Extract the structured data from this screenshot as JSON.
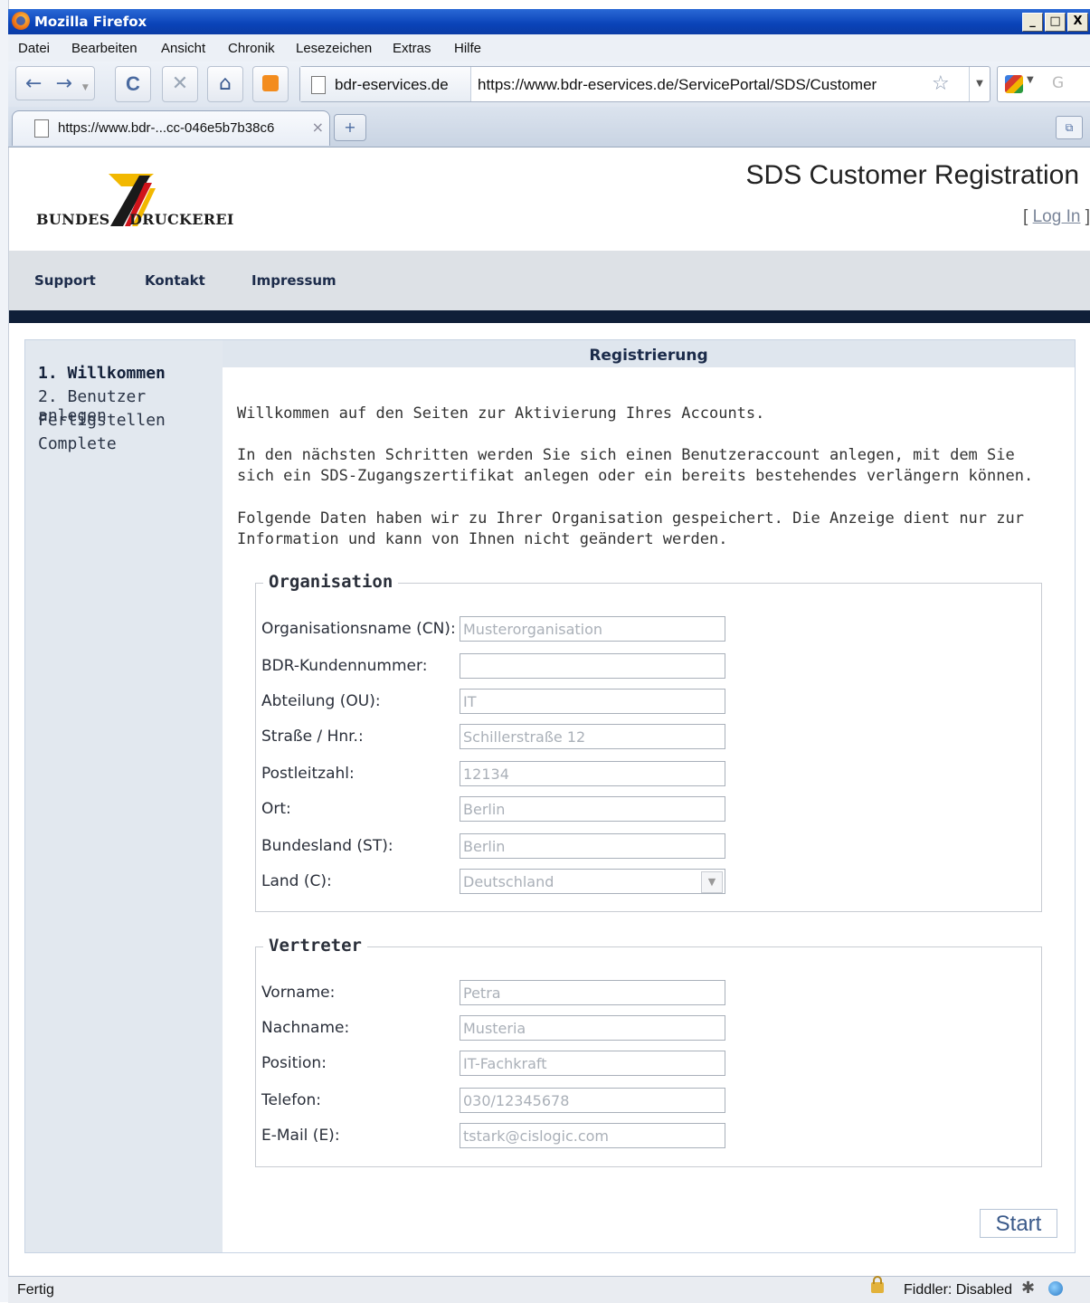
{
  "window": {
    "title": "Mozilla Firefox",
    "buttons": [
      "_",
      "□",
      "X"
    ]
  },
  "menu": [
    "Datei",
    "Bearbeiten",
    "Ansicht",
    "Chronik",
    "Lesezeichen",
    "Extras",
    "Hilfe"
  ],
  "toolbar": {
    "site_label": "bdr-eservices.de",
    "url": "https://www.bdr-eservices.de/ServicePortal/SDS/Customer",
    "search_placeholder": "G"
  },
  "tab": {
    "label": "https://www.bdr-...cc-046e5b7b38c6"
  },
  "header": {
    "logo_left": "BUNDES",
    "logo_right": "DRUCKEREI",
    "title": "SDS Customer Registration",
    "login_open": "[ ",
    "login_link": "Log In",
    "login_close": " ]"
  },
  "nav": [
    "Support",
    "Kontakt",
    "Impressum"
  ],
  "steps": [
    "1. Willkommen",
    "2. Benutzer anlegen",
    "Fertigstellen",
    "Complete"
  ],
  "main": {
    "heading": "Registrierung",
    "intro": "Willkommen auf den Seiten zur Aktivierung Ihres Accounts.",
    "para1": "In den nächsten Schritten werden Sie sich einen Benutzeraccount anlegen, mit dem Sie sich ein SDS-Zugangszertifikat anlegen oder ein bereits bestehendes verlängern können.",
    "para2": "Folgende Daten haben wir zu Ihrer Organisation gespeichert. Die Anzeige dient nur zur Information und kann von Ihnen nicht geändert werden."
  },
  "organisation": {
    "legend": "Organisation",
    "fields": [
      {
        "label": "Organisationsname (CN):",
        "value": "Musterorganisation"
      },
      {
        "label": "BDR-Kundennummer:",
        "value": ""
      },
      {
        "label": "Abteilung (OU):",
        "value": "IT"
      },
      {
        "label": "Straße / Hnr.:",
        "value": "Schillerstraße 12"
      },
      {
        "label": "Postleitzahl:",
        "value": "12134"
      },
      {
        "label": "Ort:",
        "value": "Berlin"
      },
      {
        "label": "Bundesland (ST):",
        "value": "Berlin"
      },
      {
        "label": "Land (C):",
        "value": "Deutschland"
      }
    ]
  },
  "vertreter": {
    "legend": "Vertreter",
    "fields": [
      {
        "label": "Vorname:",
        "value": "Petra"
      },
      {
        "label": "Nachname:",
        "value": "Musteria"
      },
      {
        "label": "Position:",
        "value": "IT-Fachkraft"
      },
      {
        "label": "Telefon:",
        "value": "030/12345678"
      },
      {
        "label": "E-Mail (E):",
        "value": "tstark@cislogic.com"
      }
    ]
  },
  "start_label": "Start",
  "status": {
    "text": "Fertig",
    "fiddler": "Fiddler: Disabled"
  },
  "icons": {
    "back": "←",
    "forward": "→",
    "reload": "C",
    "stop": "✕",
    "home": "⌂",
    "rss": "rss",
    "star": "☆",
    "newtab": "+",
    "close": "×"
  }
}
